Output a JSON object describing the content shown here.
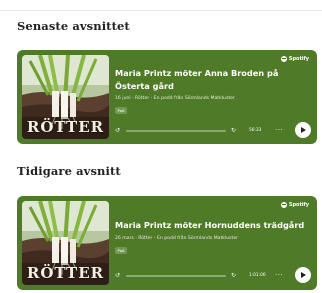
{
  "colors": {
    "card_bg": "#4f7a27",
    "heading_text": "#222222",
    "card_text": "#ffffff"
  },
  "sections": [
    {
      "heading": "Senaste avsnittet",
      "episode": {
        "cover_title": "RÖTTER",
        "provider": "Spotify",
        "title": "Maria Printz möter Anna Broden på Österta gård",
        "meta": "16 juni · Rötter - En podd från Sörmlands Matkluster",
        "badge": "Pod",
        "time": "56:33",
        "progress": 0.0,
        "icons": [
          "cover-art",
          "spotify-icon",
          "skip-back-icon",
          "skip-forward-icon",
          "more-icon",
          "play-icon"
        ]
      }
    },
    {
      "heading": "Tidigare avsnitt",
      "episode": {
        "cover_title": "RÖTTER",
        "provider": "Spotify",
        "title": "Maria Printz möter Hornuddens trädgård",
        "meta": "26 mars · Rötter - En podd från Sörmlands Matkluster",
        "badge": "Pod",
        "time": "1:01:00",
        "progress": 0.0,
        "icons": [
          "cover-art",
          "spotify-icon",
          "skip-back-icon",
          "skip-forward-icon",
          "more-icon",
          "play-icon"
        ]
      }
    }
  ]
}
